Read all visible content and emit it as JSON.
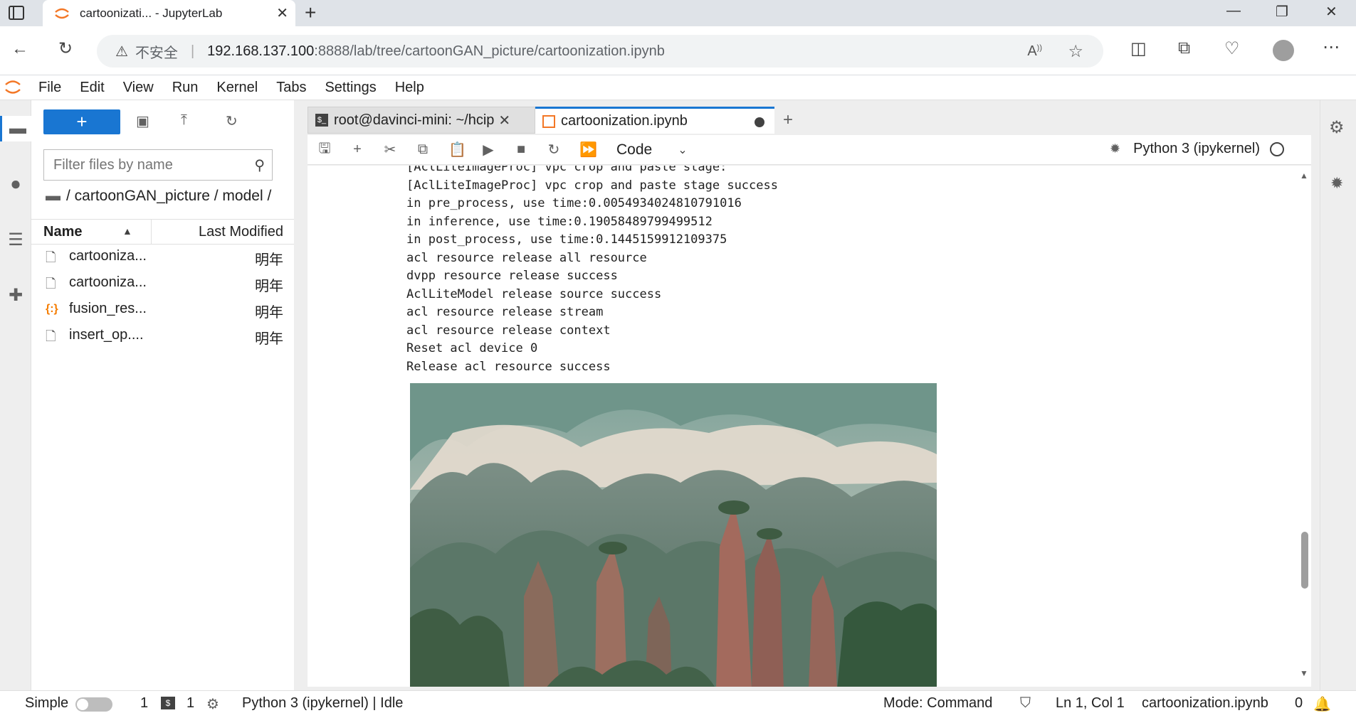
{
  "browser": {
    "tab_title": "cartoonizati... - JupyterLab",
    "close_glyph": "✕",
    "new_tab_glyph": "+",
    "insecure_label": "不安全",
    "url_host": "192.168.137.100",
    "url_path": ":8888/lab/tree/cartoonGAN_picture/cartoonization.ipynb",
    "window_controls": [
      "—",
      "❐",
      "✕"
    ]
  },
  "menu": [
    "File",
    "Edit",
    "View",
    "Run",
    "Kernel",
    "Tabs",
    "Settings",
    "Help"
  ],
  "filebrowser": {
    "new_button": "+",
    "filter_placeholder": "Filter files by name",
    "breadcrumb": "/ cartoonGAN_picture / model /",
    "col_name": "Name",
    "col_modified": "Last Modified",
    "files": [
      {
        "name": "cartooniza...",
        "modified": "明年",
        "type": "file"
      },
      {
        "name": "cartooniza...",
        "modified": "明年",
        "type": "file"
      },
      {
        "name": "fusion_res...",
        "modified": "明年",
        "type": "json"
      },
      {
        "name": "insert_op....",
        "modified": "明年",
        "type": "file"
      }
    ]
  },
  "tabs": {
    "terminal": "root@davinci-mini: ~/hcip",
    "notebook": "cartoonization.ipynb",
    "add": "+"
  },
  "notebook_toolbar": {
    "cell_type": "Code",
    "kernel": "Python 3 (ipykernel)"
  },
  "output_lines": [
    "[AclLiteImageProc] vpc crop and paste stage:",
    "[AclLiteImageProc] vpc crop and paste stage success",
    "in pre_process, use time:0.0054934024810791016",
    "in inference, use time:0.19058489799499512",
    "in post_process, use time:0.1445159912109375",
    "acl resource release all resource",
    "dvpp resource release success",
    "AclLiteModel release source success",
    "acl resource release stream",
    "acl resource release context",
    "Reset acl device 0",
    "Release acl resource success"
  ],
  "status": {
    "mode_simple": "Simple",
    "count1": "1",
    "count2": "1",
    "kernel_status": "Python 3 (ipykernel) | Idle",
    "mode": "Mode: Command",
    "cursor": "Ln 1, Col 1",
    "filename": "cartoonization.ipynb",
    "notifications": "0"
  },
  "colors": {
    "accent": "#1976d2",
    "jupyter_orange": "#f37726"
  }
}
